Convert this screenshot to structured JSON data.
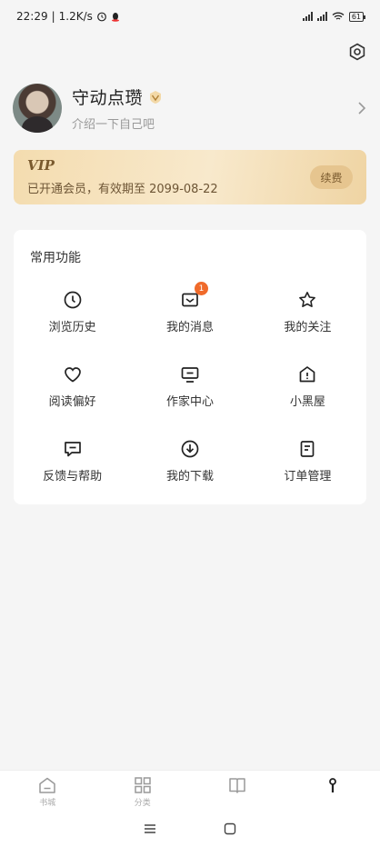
{
  "status_bar": {
    "time": "22:29",
    "speed": "1.2K/s",
    "battery": "61"
  },
  "profile": {
    "name": "守动点瓒",
    "bio": "介绍一下自己吧"
  },
  "vip": {
    "title": "VIP",
    "desc": "已开通会员，有效期至 2099-08-22",
    "renew_label": "续费"
  },
  "functions": {
    "title": "常用功能",
    "items": [
      {
        "label": "浏览历史",
        "icon": "clock-icon"
      },
      {
        "label": "我的消息",
        "icon": "message-icon",
        "badge": "1"
      },
      {
        "label": "我的关注",
        "icon": "star-icon"
      },
      {
        "label": "阅读偏好",
        "icon": "heart-icon"
      },
      {
        "label": "作家中心",
        "icon": "monitor-icon"
      },
      {
        "label": "小黑屋",
        "icon": "house-icon"
      },
      {
        "label": "反馈与帮助",
        "icon": "feedback-icon"
      },
      {
        "label": "我的下载",
        "icon": "download-icon"
      },
      {
        "label": "订单管理",
        "icon": "document-icon"
      }
    ]
  },
  "bottom_nav": {
    "items": [
      {
        "label": "书城",
        "icon": "bookstore-icon"
      },
      {
        "label": "分类",
        "icon": "grid-icon"
      },
      {
        "label": "",
        "icon": "book-icon"
      },
      {
        "label": "",
        "icon": "profile-icon"
      }
    ]
  }
}
